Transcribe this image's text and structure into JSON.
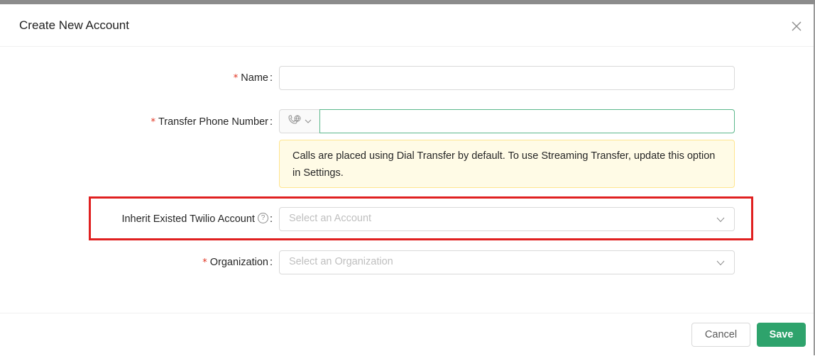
{
  "modal": {
    "title": "Create New Account"
  },
  "form": {
    "name": {
      "label": "Name",
      "value": "",
      "required": true
    },
    "transfer_phone": {
      "label": "Transfer Phone Number",
      "value": "",
      "required": true,
      "country_icon": "phone-globe-icon"
    },
    "notice": "Calls are placed using Dial Transfer by default. To use Streaming Transfer, update this option in Settings.",
    "inherit_account": {
      "label": "Inherit Existed Twilio Account",
      "placeholder": "Select an Account",
      "required": false,
      "help_icon": "question-circle-icon"
    },
    "organization": {
      "label": "Organization",
      "placeholder": "Select an Organization",
      "required": true
    },
    "required_mark": "*",
    "colon": ":"
  },
  "footer": {
    "cancel_label": "Cancel",
    "save_label": "Save"
  },
  "colors": {
    "primary": "#2ea36c",
    "required": "#e0301e",
    "highlight": "#e02020",
    "notice_bg": "#fffbe6"
  }
}
